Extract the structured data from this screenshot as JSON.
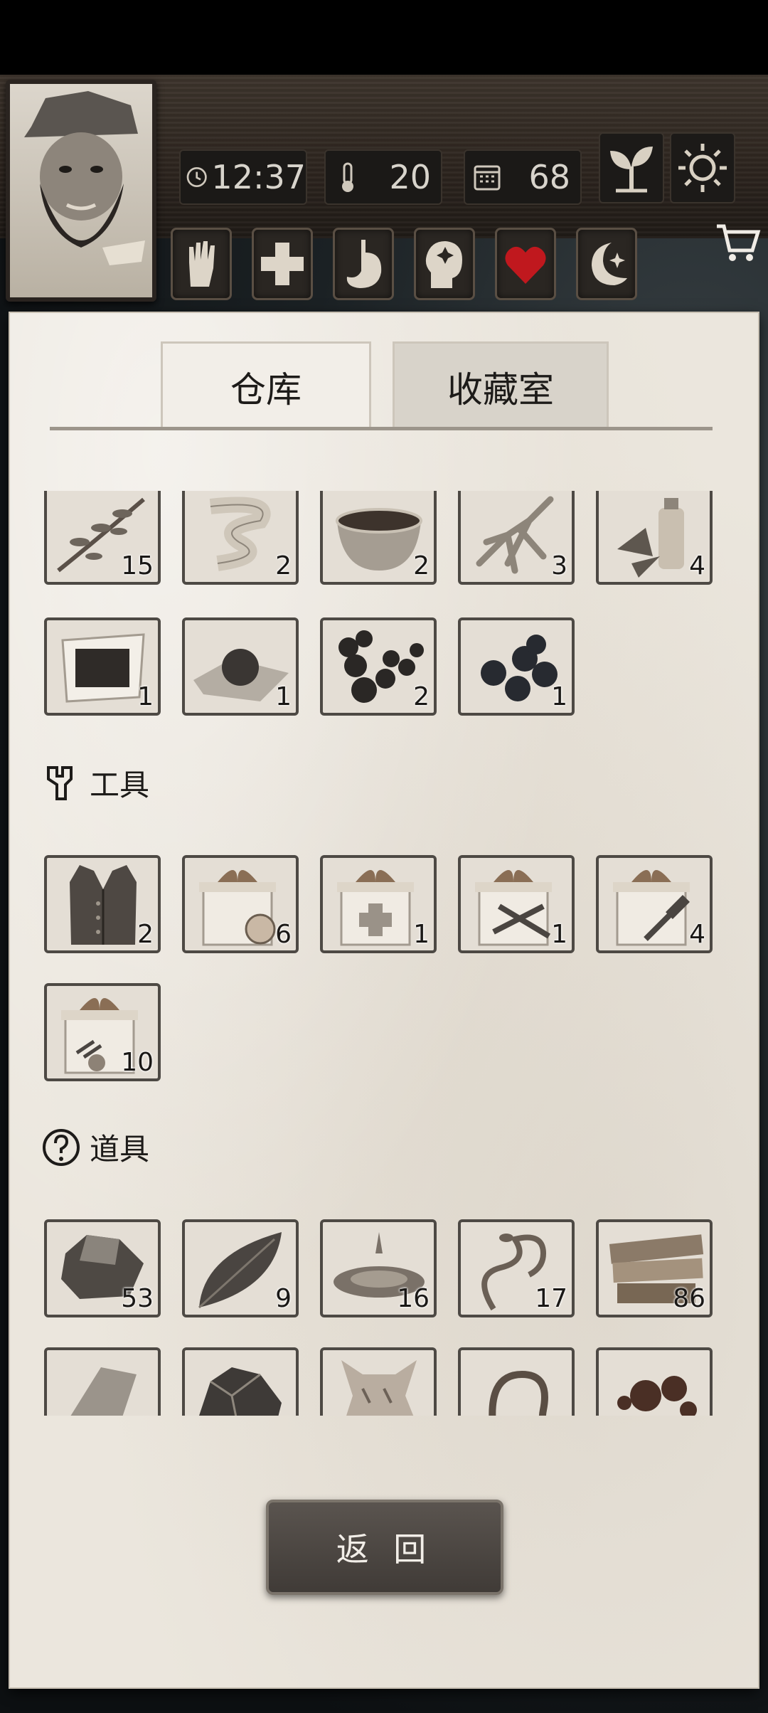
{
  "status": {
    "time": "12:37",
    "temperature": "20",
    "days": "68"
  },
  "status_icons": [
    "clock-icon",
    "thermometer-icon",
    "calendar-icon"
  ],
  "header_buttons": [
    "plant-sprout-icon",
    "sun-icon",
    "shopping-cart-icon"
  ],
  "character_stats": [
    "hand-icon",
    "health-cross-icon",
    "stomach-icon",
    "mind-icon",
    "heart-icon",
    "moon-icon"
  ],
  "colors": {
    "heart": "#c0181e",
    "paper": "#ebe6dd",
    "slot_border": "#4d4944"
  },
  "tabs": {
    "warehouse": "仓库",
    "collection": "收藏室"
  },
  "materials": [
    {
      "icon": "herb-branch-icon",
      "count": "15"
    },
    {
      "icon": "bandage-roll-icon",
      "count": "2"
    },
    {
      "icon": "broth-bowl-icon",
      "count": "2"
    },
    {
      "icon": "ginseng-root-icon",
      "count": "3"
    },
    {
      "icon": "herbal-bottle-icon",
      "count": "4"
    },
    {
      "icon": "cloth-patch-icon",
      "count": "1"
    },
    {
      "icon": "dark-ball-icon",
      "count": "1"
    },
    {
      "icon": "pills-icon",
      "count": "2"
    },
    {
      "icon": "berries-icon",
      "count": "1"
    }
  ],
  "sections": {
    "tools": "工具",
    "props": "道具"
  },
  "tools": [
    {
      "icon": "vest-icon",
      "count": "2"
    },
    {
      "icon": "food-gift-box-icon",
      "count": "6"
    },
    {
      "icon": "medical-gift-box-icon",
      "count": "1"
    },
    {
      "icon": "weapon-gift-box-icon",
      "count": "1"
    },
    {
      "icon": "tool-gift-box-icon",
      "count": "4"
    },
    {
      "icon": "material-gift-box-icon",
      "count": "10"
    }
  ],
  "props": [
    {
      "icon": "stone-icon",
      "count": "53"
    },
    {
      "icon": "leaf-icon",
      "count": "9"
    },
    {
      "icon": "water-puddle-icon",
      "count": "16"
    },
    {
      "icon": "vine-icon",
      "count": "17"
    },
    {
      "icon": "wood-planks-icon",
      "count": "86"
    },
    {
      "icon": "flint-icon",
      "count": ""
    },
    {
      "icon": "ore-icon",
      "count": ""
    },
    {
      "icon": "animal-hide-icon",
      "count": ""
    },
    {
      "icon": "rope-icon",
      "count": ""
    },
    {
      "icon": "resin-icon",
      "count": ""
    }
  ],
  "back_button": "返 回"
}
